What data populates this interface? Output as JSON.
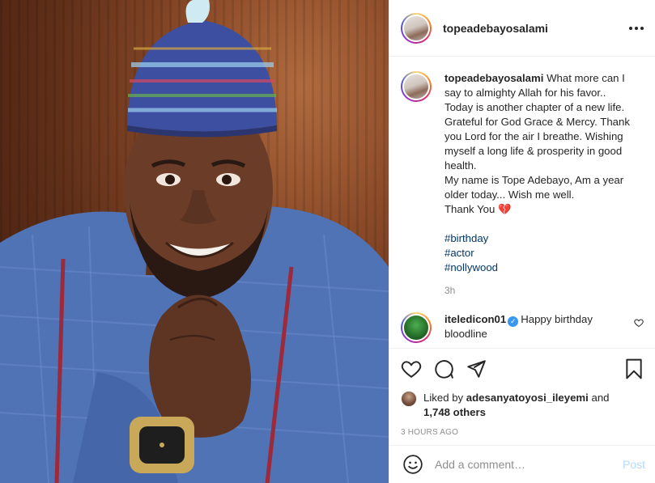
{
  "photo": {
    "alt": "Portrait of a smiling man in a blue embroidered cap and blue kaftan"
  },
  "header": {
    "username": "topeadebayosalami"
  },
  "caption": {
    "username": "topeadebayosalami",
    "lines": [
      "What more can I",
      "say to almighty Allah for his favor..",
      "Today is another chapter of a new life.",
      "Grateful for God Grace & Mercy. Thank",
      "you Lord for the air I breathe. Wishing",
      "myself a long life & prosperity in good",
      "health.",
      "My name is Tope Adebayo, Am a year",
      "older today... Wish me well.",
      "Thank You 💔"
    ],
    "hashtags": [
      "#birthday",
      "#actor",
      "#nollywood"
    ],
    "time": "3h"
  },
  "reply": {
    "username": "iteledicon01",
    "verified_mark": "✓",
    "text_line1": "Happy birthday",
    "text_line2": "bloodline"
  },
  "likes": {
    "prefix": "Liked by",
    "user": "adesanyatoyosi_ileyemi",
    "conjunction": "and",
    "others": "1,748 others"
  },
  "timestamp": "3 HOURS AGO",
  "comment_box": {
    "placeholder": "Add a comment…",
    "post_label": "Post"
  },
  "colors": {
    "link": "#00376b",
    "muted": "#8e8e8e",
    "post_disabled": "#b3dbff",
    "verified": "#3897f0"
  },
  "icons": [
    "more-icon",
    "heart-icon",
    "comment-icon",
    "share-icon",
    "bookmark-icon",
    "emoji-icon"
  ]
}
